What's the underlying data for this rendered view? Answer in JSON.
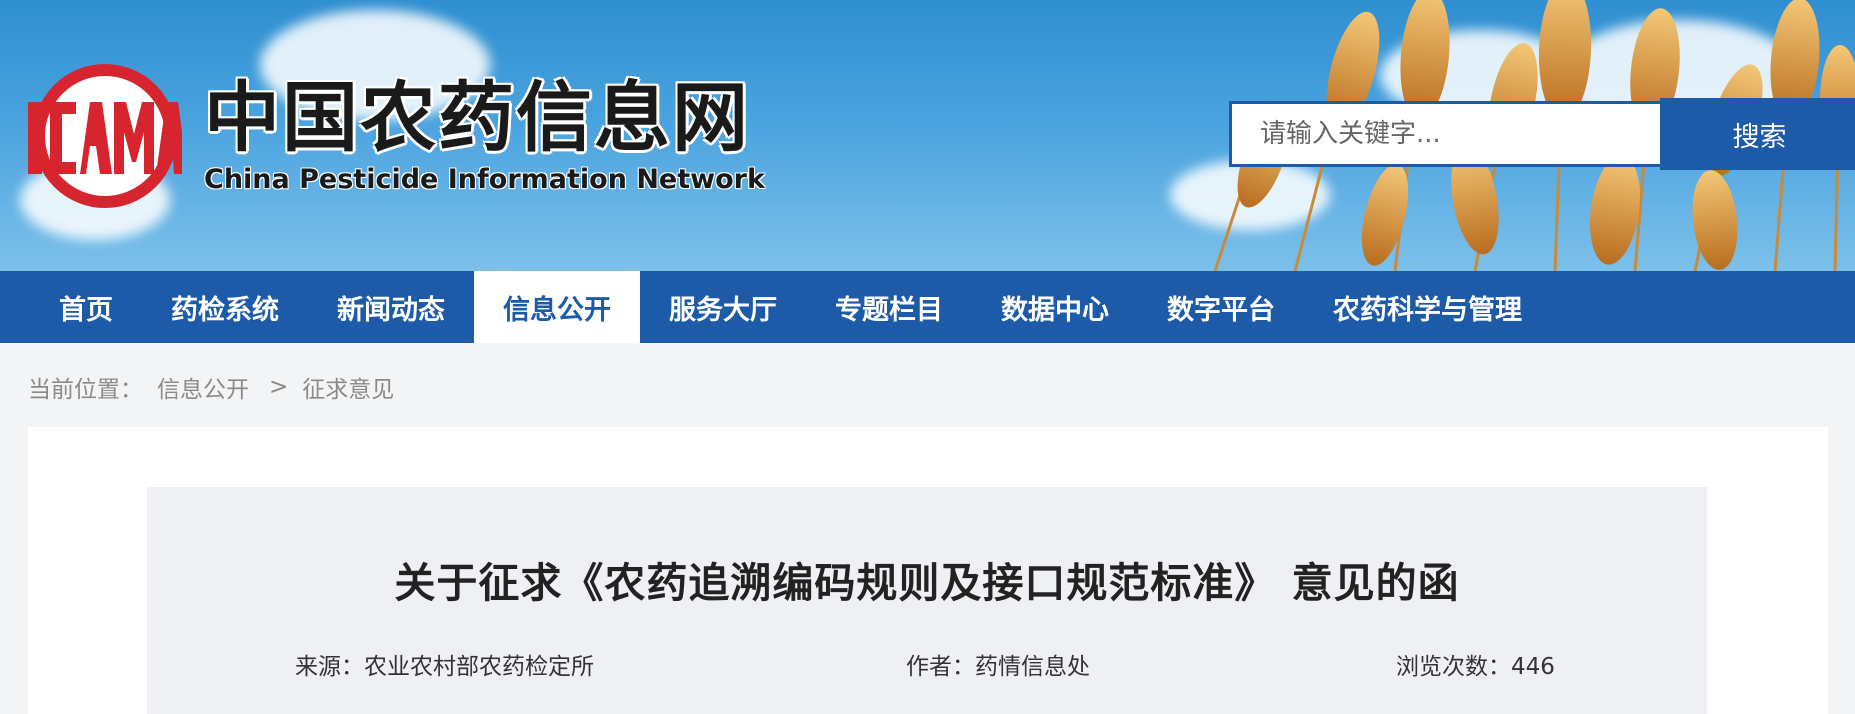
{
  "header": {
    "logo_mark": "ICAMA",
    "site_name_cn": "中国农药信息网",
    "site_name_en": "China Pesticide Information Network"
  },
  "search": {
    "placeholder": "请输入关键字...",
    "button_label": "搜索"
  },
  "nav": {
    "items": [
      {
        "label": "首页"
      },
      {
        "label": "药检系统"
      },
      {
        "label": "新闻动态"
      },
      {
        "label": "信息公开",
        "active": true
      },
      {
        "label": "服务大厅"
      },
      {
        "label": "专题栏目"
      },
      {
        "label": "数据中心"
      },
      {
        "label": "数字平台"
      },
      {
        "label": "农药科学与管理"
      }
    ]
  },
  "breadcrumb": {
    "prefix": "当前位置：",
    "items": [
      "信息公开",
      "征求意见"
    ],
    "separator": ">"
  },
  "article": {
    "title": "关于征求《农药追溯编码规则及接口规范标准》 意见的函",
    "source": "来源：农业农村部农药检定所",
    "author": "作者：药情信息处",
    "views": "浏览次数：446"
  },
  "colors": {
    "brand_blue": "#1d5aa8",
    "logo_red": "#d7252f",
    "page_bg": "#f3f4f6",
    "panel_bg": "#eef0f4"
  },
  "icons": [
    "icama-logo",
    "wheat-decoration"
  ]
}
